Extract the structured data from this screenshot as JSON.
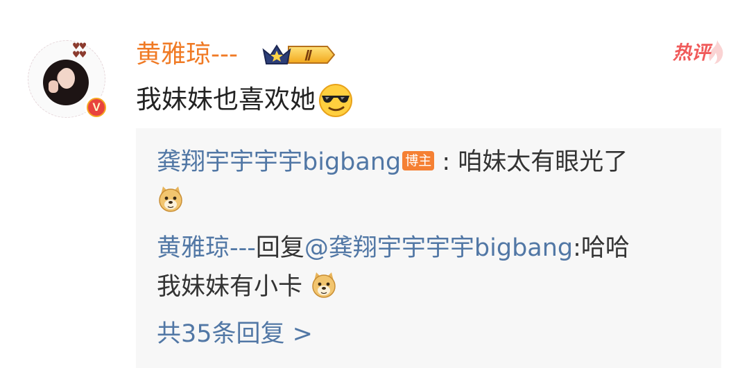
{
  "comment": {
    "username": "黄雅琼---",
    "level_badge": "Ⅱ",
    "hot_tag": "热评",
    "text": "我妹妹也喜欢她",
    "verified_badge": "V",
    "emoji": "cool-sunglasses-emoji"
  },
  "replies": {
    "items": [
      {
        "author": "龚翔宇宇宇宇bigbang",
        "author_tag": "博主",
        "separator": " : ",
        "text": "咱妹太有眼光了",
        "emoji": "doge-emoji"
      },
      {
        "author": "黄雅琼---",
        "reply_word": "回复",
        "mention": "@龚翔宇宇宇宇bigbang",
        "text_after_mention": ":哈哈",
        "text_line2": "我妹妹有小卡",
        "emoji": "doge-emoji"
      }
    ],
    "more_label": "共35条回复 >"
  },
  "colors": {
    "username": "#f07a24",
    "link_blue": "#5177a5",
    "hot_red": "#f05a5a",
    "badge_orange": "#f58033"
  }
}
